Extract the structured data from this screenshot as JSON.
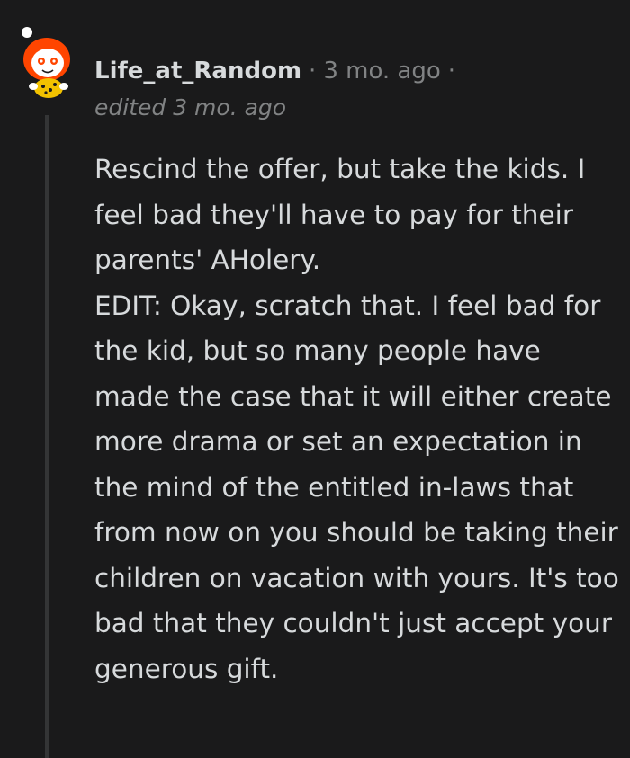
{
  "comment": {
    "username": "Life_at_Random",
    "separator": "·",
    "timestamp": "3 mo. ago",
    "edited": "edited 3 mo. ago",
    "paragraphs": [
      "Rescind the offer, but take the kids. I feel bad they'll have to pay for their parents' AHolery.",
      "EDIT: Okay, scratch that. I feel bad for the kid, but so many people have made the case that it will either create more drama or set an expectation in the mind of the entitled in-laws that from now on you should be taking their children on vacation with yours. It's too bad that they couldn't just accept your generous gift."
    ]
  },
  "colors": {
    "background": "#1a1a1b",
    "text": "#d7dadc",
    "muted": "#818384",
    "thread_line": "#343536",
    "avatar_accent": "#ff4500"
  },
  "icons": {
    "avatar": "snoo-avatar-icon"
  }
}
